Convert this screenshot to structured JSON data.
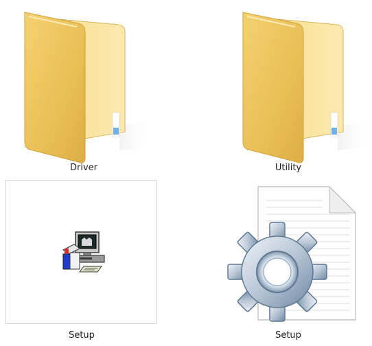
{
  "items": [
    {
      "label": "Driver",
      "icon": "folder-icon"
    },
    {
      "label": "Utility",
      "icon": "folder-icon"
    },
    {
      "label": "Setup",
      "icon": "installer-exe-icon"
    },
    {
      "label": "Setup",
      "icon": "settings-file-gear-icon"
    }
  ]
}
